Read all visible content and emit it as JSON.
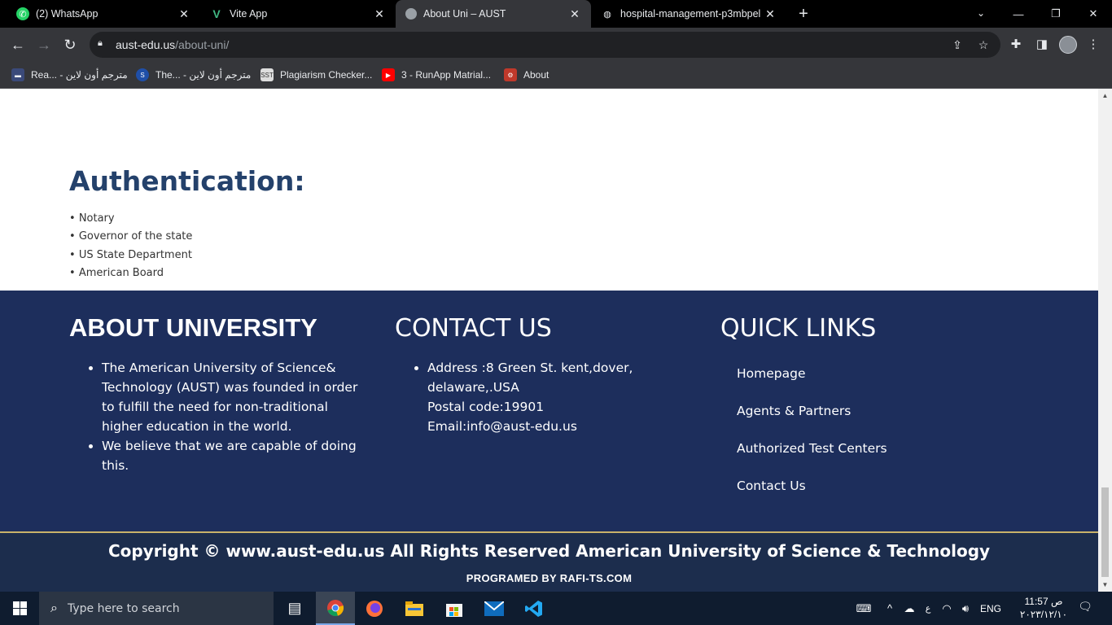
{
  "browser": {
    "tabs": [
      {
        "title": "(2) WhatsApp",
        "icon": "whatsapp-icon",
        "active": false
      },
      {
        "title": "Vite App",
        "icon": "vite-icon",
        "active": false
      },
      {
        "title": "About Uni – AUST",
        "icon": "globe-icon",
        "active": true
      },
      {
        "title": "hospital-management-p3mbpel",
        "icon": "globe-icon",
        "active": false
      }
    ],
    "url_domain": "aust-edu.us",
    "url_path": "/about-uni/",
    "bookmarks": [
      {
        "label": "Rea... - مترجم أون لاين"
      },
      {
        "label": "The... - مترجم أون لاين"
      },
      {
        "label": "Plagiarism Checker..."
      },
      {
        "label": "3 - RunApp Matrial..."
      },
      {
        "label": "About"
      }
    ]
  },
  "page": {
    "authentication": {
      "title": "Authentication:",
      "items": [
        "Notary",
        "Governor of the state",
        "US State Department",
        "American Board"
      ]
    },
    "footer": {
      "about": {
        "heading": "ABOUT UNIVERSITY",
        "items": [
          "The American University of Science& Technology (AUST) was founded in order to fulfill the need for non-traditional higher education in the world.",
          "We believe that we are capable of doing this."
        ]
      },
      "contact": {
        "heading": "CONTACT US",
        "address": "Address :8 Green St. kent,dover, delaware,.USA",
        "postal": "Postal code:19901",
        "email": "Email:info@aust-edu.us"
      },
      "quick_links": {
        "heading": "QUICK LINKS",
        "links": [
          "Homepage",
          "Agents & Partners",
          "Authorized Test Centers",
          "Contact Us"
        ]
      }
    },
    "copyright": "Copyright © www.aust-edu.us All Rights Reserved American University of Science & Technology",
    "programmed_by": "PROGRAMED BY RAFI-TS.COM"
  },
  "taskbar": {
    "search_placeholder": "Type here to search",
    "language": "ENG",
    "time": "11:57 ص",
    "date": "٢٠٢٣/١٢/١٠"
  },
  "colors": {
    "footer_bg": "#1d2e5c",
    "auth_title": "#24416b",
    "copy_border": "#c9b26a"
  }
}
